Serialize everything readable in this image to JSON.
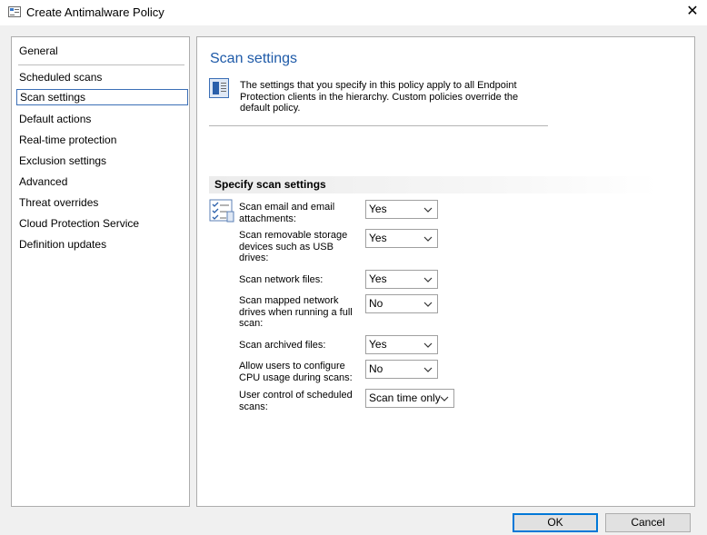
{
  "window": {
    "title": "Create Antimalware Policy",
    "close_glyph": "✕"
  },
  "nav": {
    "items": [
      {
        "label": "General",
        "selected": false
      },
      {
        "label": "Scheduled scans",
        "selected": false
      },
      {
        "label": "Scan settings",
        "selected": true
      },
      {
        "label": "Default actions",
        "selected": false
      },
      {
        "label": "Real-time protection",
        "selected": false
      },
      {
        "label": "Exclusion settings",
        "selected": false
      },
      {
        "label": "Advanced",
        "selected": false
      },
      {
        "label": "Threat overrides",
        "selected": false
      },
      {
        "label": "Cloud Protection Service",
        "selected": false
      },
      {
        "label": "Definition updates",
        "selected": false
      }
    ]
  },
  "main": {
    "title": "Scan settings",
    "description": "The settings that you specify in this policy apply to all Endpoint Protection clients in the hierarchy. Custom policies override the default policy.",
    "section_title": "Specify scan settings",
    "settings": [
      {
        "label": "Scan email and email attachments:",
        "value": "Yes"
      },
      {
        "label": "Scan removable storage devices such as USB drives:",
        "value": "Yes"
      },
      {
        "label": "Scan network files:",
        "value": "Yes"
      },
      {
        "label": "Scan mapped network drives when running a full scan:",
        "value": "No"
      },
      {
        "label": "Scan archived files:",
        "value": "Yes"
      },
      {
        "label": "Allow users to configure CPU usage during scans:",
        "value": "No"
      },
      {
        "label": "User control of scheduled scans:",
        "value": "Scan time only"
      }
    ]
  },
  "footer": {
    "ok_label": "OK",
    "cancel_label": "Cancel"
  },
  "colors": {
    "accent": "#0078d7",
    "heading": "#1e5aa8",
    "selection_border": "#3c6fb6"
  },
  "icons": {
    "app": "policy-window-icon",
    "info": "policy-document-icon",
    "settings_list": "checklist-icon",
    "dropdown": "chevron-down-icon"
  }
}
